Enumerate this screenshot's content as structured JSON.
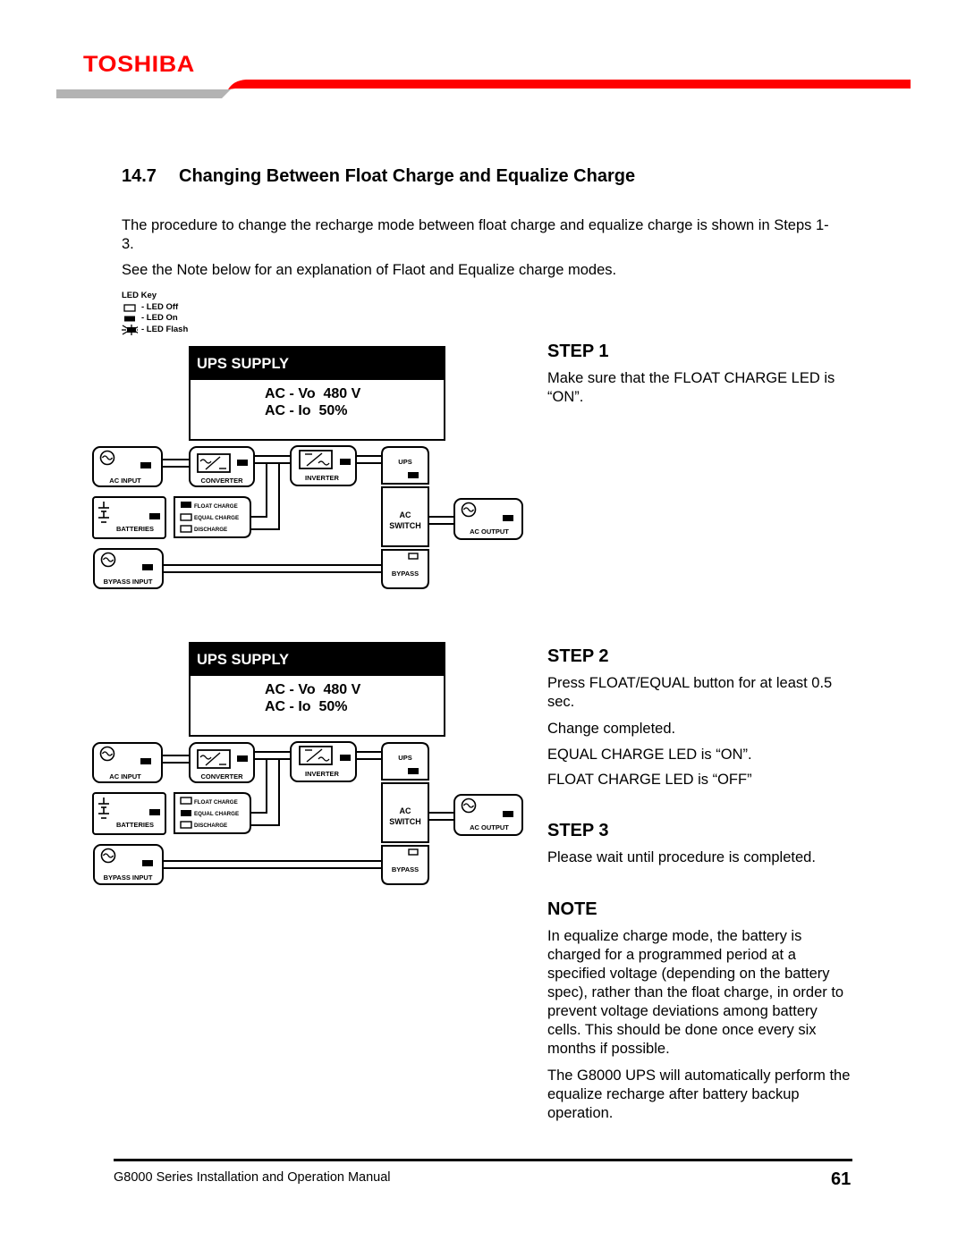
{
  "header": {
    "brand": "TOSHIBA",
    "brand_color": "#ff0000",
    "bar_gray": "#b3b3b3",
    "bar_red": "#ff0000"
  },
  "section": {
    "number": "14.7",
    "title": "Changing Between Float Charge and Equalize Charge"
  },
  "intro": {
    "p1": "The procedure to change the recharge mode between float charge and equalize charge is shown in Steps 1-3.",
    "p2": "See the Note below for an explanation of Flaot and Equalize charge modes."
  },
  "led_key": {
    "title": "LED Key",
    "items": [
      {
        "icon": "led-off-icon",
        "label": "- LED Off"
      },
      {
        "icon": "led-on-icon",
        "label": "- LED On"
      },
      {
        "icon": "led-flash-icon",
        "label": "- LED Flash"
      }
    ]
  },
  "diagram_labels": {
    "panel_title": "UPS SUPPLY",
    "voltage_line": "AC - Vo  480 V",
    "current_line": "AC - Io  50%",
    "ac_input": "AC INPUT",
    "converter": "CONVERTER",
    "inverter": "INVERTER",
    "ups": "UPS",
    "batteries": "BATTERIES",
    "float_charge": "FLOAT CHARGE",
    "equal_charge": "EQUAL CHARGE",
    "discharge": "DISCHARGE",
    "ac_switch_1": "AC",
    "ac_switch_2": "SWITCH",
    "ac_output": "AC OUTPUT",
    "bypass": "BYPASS",
    "bypass_input": "BYPASS INPUT"
  },
  "diagrams": [
    {
      "id": "step1",
      "leds": {
        "ac_input": "on",
        "converter": "on",
        "inverter": "on",
        "ups": "on",
        "batteries": "on",
        "float_charge": "on",
        "equal_charge": "off",
        "discharge": "off",
        "ac_output": "on",
        "bypass": "off",
        "bypass_input": "on"
      }
    },
    {
      "id": "step2",
      "leds": {
        "ac_input": "on",
        "converter": "on",
        "inverter": "on",
        "ups": "on",
        "batteries": "on",
        "float_charge": "off",
        "equal_charge": "on",
        "discharge": "off",
        "ac_output": "on",
        "bypass": "off",
        "bypass_input": "on"
      }
    }
  ],
  "steps": {
    "step1": {
      "heading": "STEP 1",
      "text": "Make sure that the FLOAT CHARGE LED is “ON”."
    },
    "step2": {
      "heading": "STEP 2",
      "text1": "Press FLOAT/EQUAL button for at least 0.5 sec.",
      "text2": "Change completed.",
      "text3": "EQUAL CHARGE LED is “ON”.",
      "text4": "FLOAT CHARGE LED is “OFF”"
    },
    "step3": {
      "heading": "STEP 3",
      "text": "Please wait until procedure is completed."
    }
  },
  "note": {
    "heading": "NOTE",
    "p1": "In equalize charge mode, the battery is charged for a programmed period at a specified voltage (depending on the battery spec), rather than the float charge, in order to prevent voltage deviations among battery cells. This should be done once every six months if possible.",
    "p2": "The G8000 UPS will automatically perform the equalize recharge after battery backup operation."
  },
  "footer": {
    "manual_title": "G8000 Series Installation and Operation Manual",
    "page_number": "61"
  }
}
